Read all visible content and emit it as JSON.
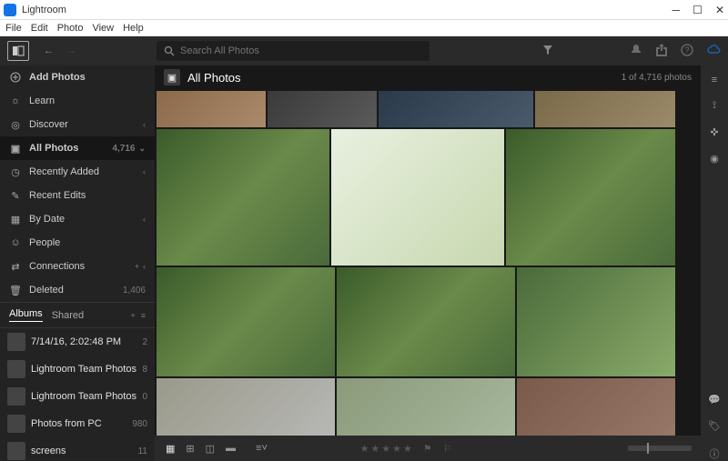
{
  "app": {
    "name": "Lightroom"
  },
  "menubar": [
    "File",
    "Edit",
    "Photo",
    "View",
    "Help"
  ],
  "search": {
    "placeholder": "Search All Photos"
  },
  "sidebar": {
    "add_photos": "Add Photos",
    "learn": "Learn",
    "discover": "Discover",
    "library": [
      {
        "label": "All Photos",
        "count": "4,716",
        "active": true
      },
      {
        "label": "Recently Added"
      },
      {
        "label": "Recent Edits"
      },
      {
        "label": "By Date"
      },
      {
        "label": "People"
      },
      {
        "label": "Connections",
        "plus": true
      },
      {
        "label": "Deleted",
        "count": "1,406"
      }
    ],
    "albums_tabs": {
      "albums": "Albums",
      "shared": "Shared"
    },
    "albums": [
      {
        "label": "7/14/16, 2:02:48 PM",
        "count": "2"
      },
      {
        "label": "Lightroom Team Photos",
        "count": "8"
      },
      {
        "label": "Lightroom Team Photos",
        "count": "0"
      },
      {
        "label": "Photos from PC",
        "count": "980"
      },
      {
        "label": "screens",
        "count": "11"
      }
    ]
  },
  "content": {
    "title": "All Photos",
    "count_text": "1 of 4,716 photos"
  }
}
